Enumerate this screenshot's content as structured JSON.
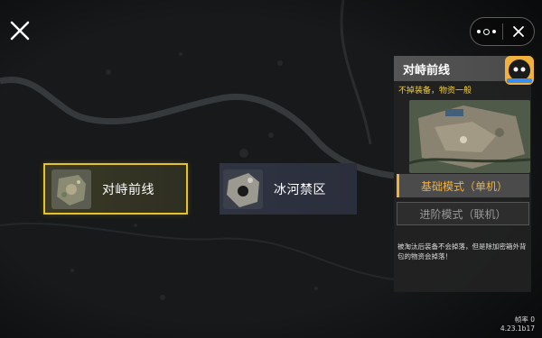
{
  "header": {
    "close_icon": "close-x-icon",
    "more_icon": "more-dots-icon",
    "capsule_close_icon": "close-icon"
  },
  "maps": [
    {
      "label": "对峙前线",
      "selected": true
    },
    {
      "label": "冰河禁区",
      "selected": false
    }
  ],
  "detail": {
    "title": "对峙前线",
    "subtitle": "不掉装备，物资一般",
    "mode_basic": "基础模式（单机）",
    "mode_advanced": "进阶模式（联机）",
    "note": "被淘汰后装备不会掉落，但是除加密箱外背包的物资会掉落！"
  },
  "footer": {
    "fps": "帧率 0",
    "version": "4.23.1b17"
  },
  "colors": {
    "accent_yellow": "#e6c229",
    "accent_orange": "#f2b13b",
    "subtitle_yellow": "#f2cf3c"
  }
}
